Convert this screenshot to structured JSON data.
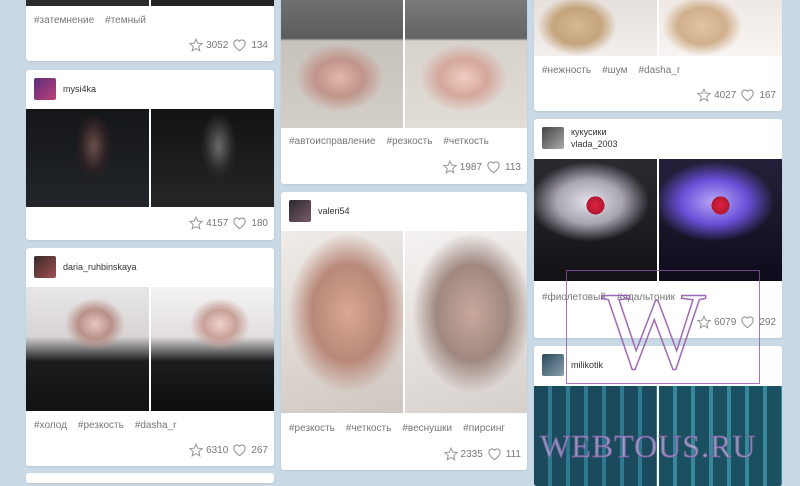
{
  "columns": [
    {
      "cards": [
        {
          "id": "c1a",
          "tags": [
            "#затемнение",
            "#темный"
          ],
          "stars": "3052",
          "likes": "134"
        },
        {
          "id": "c1b",
          "username": "mysi4ka",
          "stars": "4157",
          "likes": "180"
        },
        {
          "id": "c1c",
          "username": "daria_ruhbinskaya",
          "tags": [
            "#холод",
            "#резкость",
            "#dasha_r"
          ],
          "stars": "6310",
          "likes": "267"
        }
      ]
    },
    {
      "cards": [
        {
          "id": "c2a",
          "tags": [
            "#автоисправление",
            "#резкость",
            "#четкость"
          ],
          "stars": "1987",
          "likes": "113"
        },
        {
          "id": "c2b",
          "username": "valeri54",
          "tags": [
            "#резкость",
            "#четкость",
            "#веснушки",
            "#пирсинг"
          ],
          "stars": "2335",
          "likes": "111"
        }
      ]
    },
    {
      "cards": [
        {
          "id": "c3a",
          "tags": [
            "#нежность",
            "#шум",
            "#dasha_r"
          ],
          "stars": "4027",
          "likes": "167"
        },
        {
          "id": "c3b",
          "title": "кукусики",
          "username": "vlada_2003",
          "tags": [
            "#фиолетовый",
            "#ядальтоник"
          ],
          "stars": "6079",
          "likes": "292"
        },
        {
          "id": "c3c",
          "username": "milikotik"
        }
      ]
    }
  ],
  "watermark": {
    "letter": "W",
    "site": "WEBTOUS.RU"
  },
  "icons": {
    "star": "star-icon",
    "like": "heart-icon"
  }
}
